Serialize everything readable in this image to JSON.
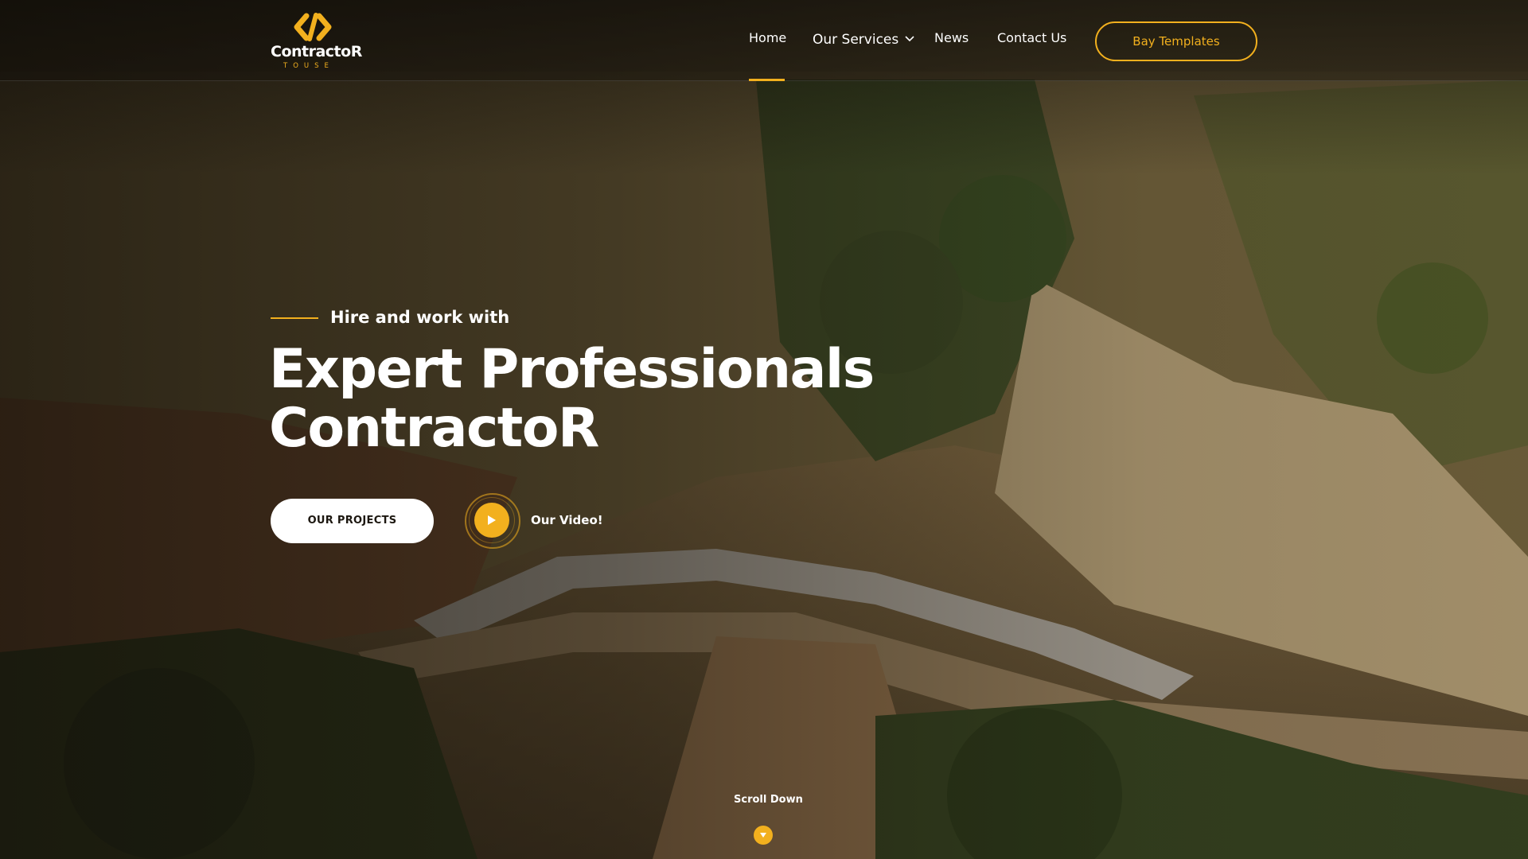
{
  "brand": {
    "name": "ContractoR",
    "sub": "TOUSE",
    "accent_color": "#f2b01e",
    "logo_icon": "code-bracket-logo-icon"
  },
  "nav": {
    "items": [
      {
        "label": "Home",
        "active": true
      },
      {
        "label": "Our Services",
        "has_dropdown": true
      },
      {
        "label": "News"
      },
      {
        "label": "Contact Us"
      }
    ],
    "cta_label": "Bay Templates"
  },
  "hero": {
    "kicker": "Hire and work with",
    "title_line1": "Expert Professionals",
    "title_line2": "ContractoR",
    "primary_button": "OUR PROJECTS",
    "video_label": "Our Video!",
    "play_icon": "play-icon",
    "scroll_label": "Scroll Down",
    "scroll_icon": "arrow-down-icon"
  }
}
